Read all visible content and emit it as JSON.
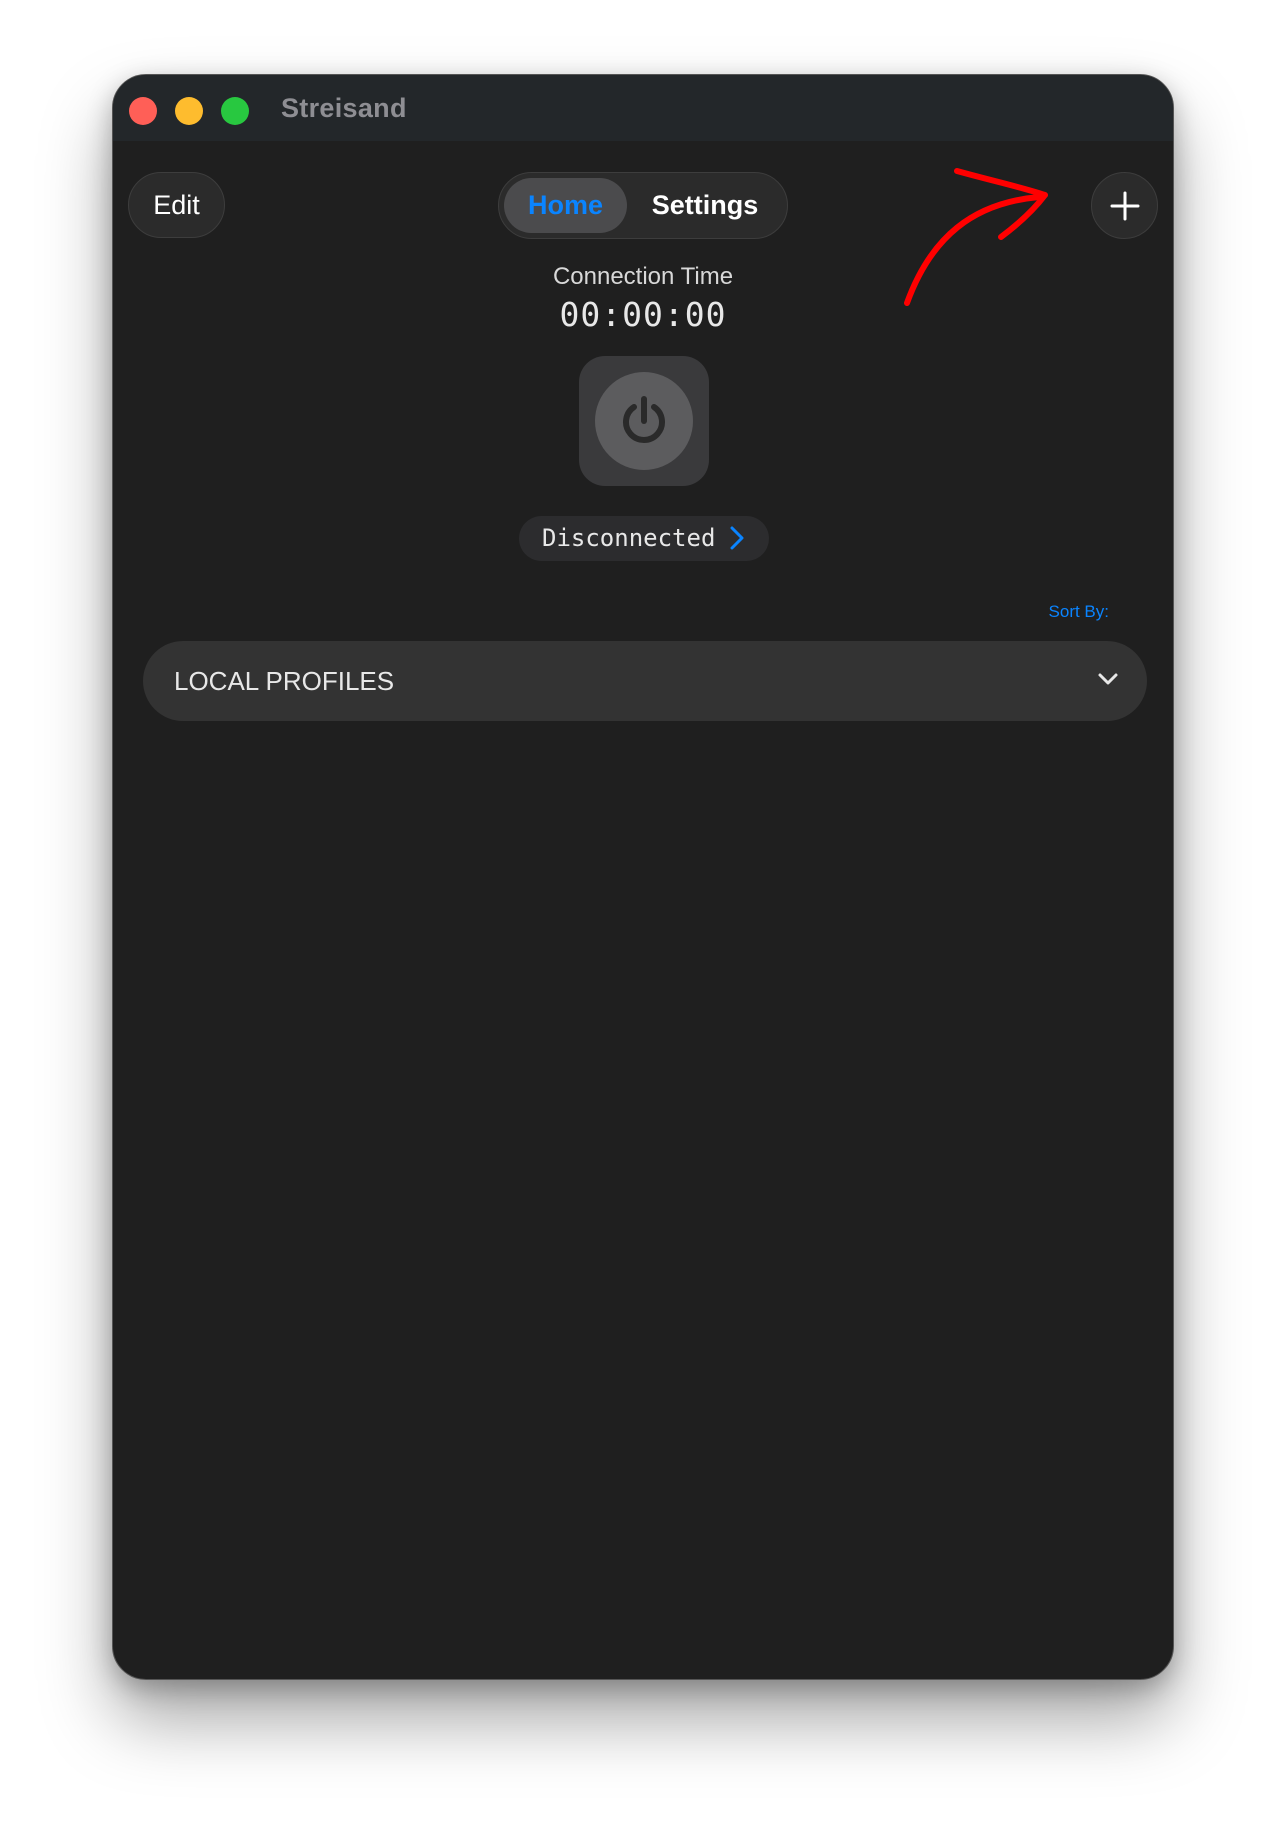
{
  "window": {
    "title": "Streisand"
  },
  "toolbar": {
    "edit_label": "Edit",
    "tabs": [
      {
        "label": "Home",
        "selected": true
      },
      {
        "label": "Settings",
        "selected": false
      }
    ],
    "add_icon": "plus-icon"
  },
  "connection": {
    "label": "Connection Time",
    "time": "00:00:00",
    "power_icon": "power-icon",
    "status": "Disconnected"
  },
  "profiles": {
    "sort_label": "Sort By:",
    "section_title": "LOCAL PROFILES",
    "expand_icon": "chevron-down-icon"
  },
  "colors": {
    "accent": "#0a84ff",
    "window_bg": "#1f1f1f",
    "annotation": "#ff0000"
  }
}
